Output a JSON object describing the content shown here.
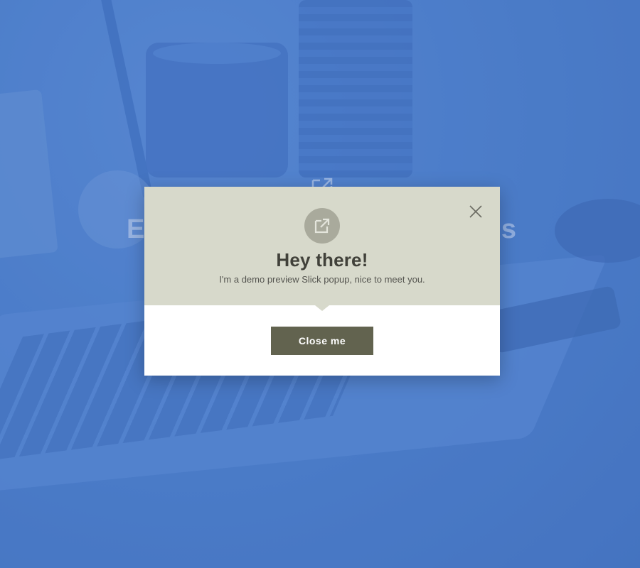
{
  "background": {
    "overlay_color": "#4f7fca",
    "ghost_heading_left": "E",
    "ghost_heading_right": "s"
  },
  "popup": {
    "header_bg": "#d7d9cb",
    "badge_icon": "external-link-icon",
    "close_icon": "close-icon",
    "title": "Hey there!",
    "subtitle": "I'm a demo preview Slick popup, nice to meet you.",
    "button_label": "Close me",
    "button_color": "#62634f"
  }
}
